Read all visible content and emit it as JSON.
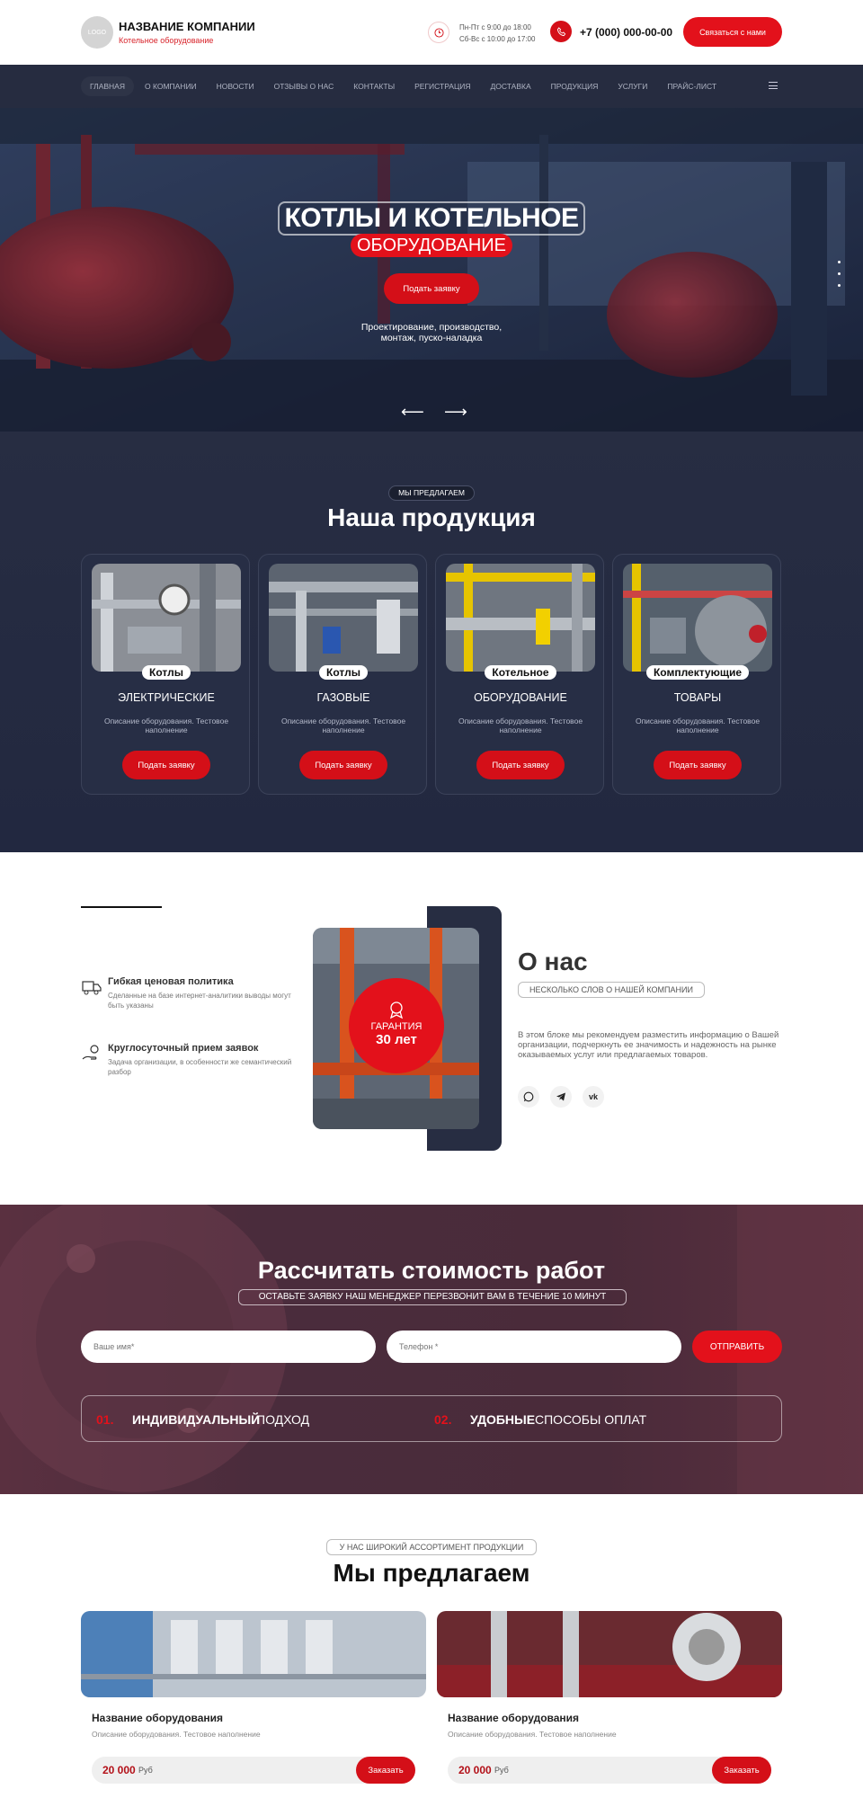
{
  "header": {
    "logo_text": "LOGO",
    "company_name": "НАЗВАНИЕ КОМПАНИИ",
    "company_sub": "Котельное оборудование",
    "hours_line1": "Пн-Пт с 9:00 до 18:00",
    "hours_line2": "Сб-Вс с 10:00 до 17:00",
    "phone": "+7 (000) 000-00-00",
    "call_button": "Связаться с нами"
  },
  "nav": {
    "items": [
      "ГЛАВНАЯ",
      "О КОМПАНИИ",
      "НОВОСТИ",
      "ОТЗЫВЫ О НАС",
      "КОНТАКТЫ",
      "РЕГИСТРАЦИЯ",
      "ДОСТАВКА",
      "ПРОДУКЦИЯ",
      "УСЛУГИ",
      "ПРАЙС-ЛИСТ"
    ]
  },
  "hero": {
    "title_line1": "КОТЛЫ И КОТЕЛЬНОЕ",
    "title_line2": "ОБОРУДОВАНИЕ",
    "button": "Подать заявку",
    "subtitle_line1": "Проектирование, производство,",
    "subtitle_line2": "монтаж, пуско-наладка",
    "prev_arrow": "⟵",
    "next_arrow": "⟶"
  },
  "products": {
    "pill": "МЫ ПРЕДЛАГАЕМ",
    "title": "Наша продукция",
    "cards": [
      {
        "tag": "Котлы",
        "title": "ЭЛЕКТРИЧЕСКИЕ",
        "desc": "Описание оборудования. Тестовое наполнение",
        "button": "Подать заявку"
      },
      {
        "tag": "Котлы",
        "title": "ГАЗОВЫЕ",
        "desc": "Описание оборудования. Тестовое наполнение",
        "button": "Подать заявку"
      },
      {
        "tag": "Котельное",
        "title": "ОБОРУДОВАНИЕ",
        "desc": "Описание оборудования. Тестовое наполнение",
        "button": "Подать заявку"
      },
      {
        "tag": "Комплектующие",
        "title": "ТОВАРЫ",
        "desc": "Описание оборудования. Тестовое наполнение",
        "button": "Подать заявку"
      }
    ]
  },
  "about": {
    "feature1_title": "Гибкая ценовая политика",
    "feature1_desc": "Сделанные на базе интернет-аналитики выводы могут быть указаны",
    "feature2_title": "Круглосуточный прием заявок",
    "feature2_desc": "Задача организации, в особенности же семантический разбор",
    "badge_line1": "ГАРАНТИЯ",
    "badge_line2": "30 лет",
    "title": "О нас",
    "pill": "НЕСКОЛЬКО СЛОВ О НАШЕЙ КОМПАНИИ",
    "text": "В этом блоке мы рекомендуем разместить информацию о Вашей организации, подчеркнуть ее значимость и надежность на рынке оказываемых услуг или предлагаемых товаров.",
    "social": [
      "whatsapp-icon",
      "telegram-icon",
      "vk-icon"
    ],
    "vk_text": "vk"
  },
  "calc": {
    "title": "Рассчитать стоимость работ",
    "pill": "ОСТАВЬТЕ ЗАЯВКУ НАШ МЕНЕДЖЕР ПЕРЕЗВОНИТ ВАМ В ТЕЧЕНИЕ 10 МИНУТ",
    "name_placeholder": "Ваше имя*",
    "phone_placeholder": "Телефон *",
    "send_button": "ОТПРАВИТЬ",
    "adv1_num": "01.",
    "adv1_bold": "ИНДИВИДУАЛЬНЫЙ",
    "adv1_rest": "ПОДХОД",
    "adv2_num": "02.",
    "adv2_bold": "УДОБНЫЕ",
    "adv2_rest": "СПОСОБЫ ОПЛАТ"
  },
  "offer": {
    "pill": "У НАС ШИРОКИЙ АССОРТИМЕНТ ПРОДУКЦИИ",
    "title": "Мы предлагаем",
    "cards": [
      {
        "title": "Название оборудования",
        "desc": "Описание оборудования. Тестовое наполнение",
        "price": "20 000",
        "unit": "Руб",
        "button": "Заказать"
      },
      {
        "title": "Название оборудования",
        "desc": "Описание оборудования. Тестовое наполнение",
        "price": "20 000",
        "unit": "Руб",
        "button": "Заказать"
      }
    ]
  },
  "colors": {
    "accent": "#e3111b",
    "dark": "#272d42",
    "wine": "#4a2b3a"
  }
}
